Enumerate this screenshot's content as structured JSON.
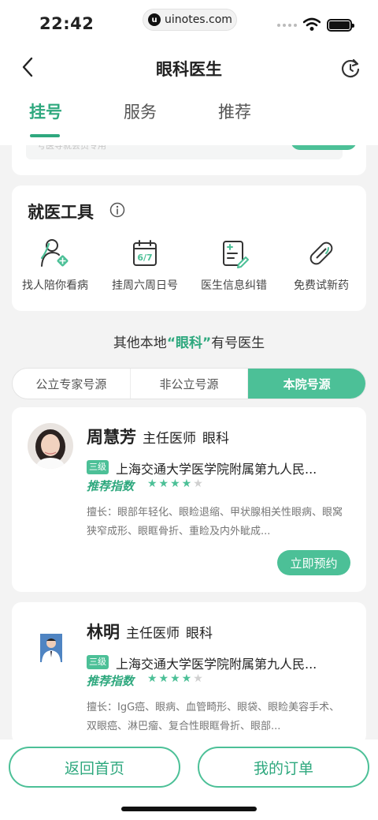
{
  "status": {
    "time": "22:42",
    "url": "uinotes.com"
  },
  "header": {
    "title": "眼科医生",
    "back_icon": "chevron-left-icon",
    "refresh_icon": "refresh-icon"
  },
  "tabs": [
    {
      "label": "挂号",
      "active": true
    },
    {
      "label": "服务",
      "active": false
    },
    {
      "label": "推荐",
      "active": false
    }
  ],
  "prev_card": {
    "text": "号医导就会员专用"
  },
  "tools": {
    "title": "就医工具",
    "items": [
      {
        "label": "找人陪你看病",
        "icon": "companion-icon"
      },
      {
        "label": "挂周六周日号",
        "icon": "calendar-icon",
        "icon_text": "6/7"
      },
      {
        "label": "医生信息纠错",
        "icon": "edit-document-icon"
      },
      {
        "label": "免费试新药",
        "icon": "pill-icon"
      }
    ]
  },
  "local": {
    "prefix": "其他本地",
    "highlight": "“眼科”",
    "suffix": "有号医生"
  },
  "segments": [
    {
      "label": "公立专家号源",
      "active": false
    },
    {
      "label": "非公立号源",
      "active": false
    },
    {
      "label": "本院号源",
      "active": true
    }
  ],
  "doctors": [
    {
      "name": "周慧芳",
      "title": "主任医师",
      "dept": "眼科",
      "level": "三级",
      "hospital": "上海交通大学医学院附属第九人民...",
      "rec_label": "推荐指数",
      "rating": 4,
      "rating_max": 5,
      "specialty": "擅长：眼部年轻化、眼睑退缩、甲状腺相关性眼病、眼窝狭窄成形、眼眶骨折、重睑及内外眦成...",
      "book_label": "立即预约"
    },
    {
      "name": "林明",
      "title": "主任医师",
      "dept": "眼科",
      "level": "三级",
      "hospital": "上海交通大学医学院附属第九人民...",
      "rec_label": "推荐指数",
      "rating": 4,
      "rating_max": 5,
      "specialty": "擅长：IgG癌、眼病、血管畸形、眼袋、眼睑美容手术、双眼癌、淋巴瘤、复合性眼眶骨折、眼部..."
    }
  ],
  "bottom": {
    "home_label": "返回首页",
    "orders_label": "我的订单"
  },
  "colors": {
    "accent": "#2ea87e",
    "accent_light": "#4cc097"
  }
}
